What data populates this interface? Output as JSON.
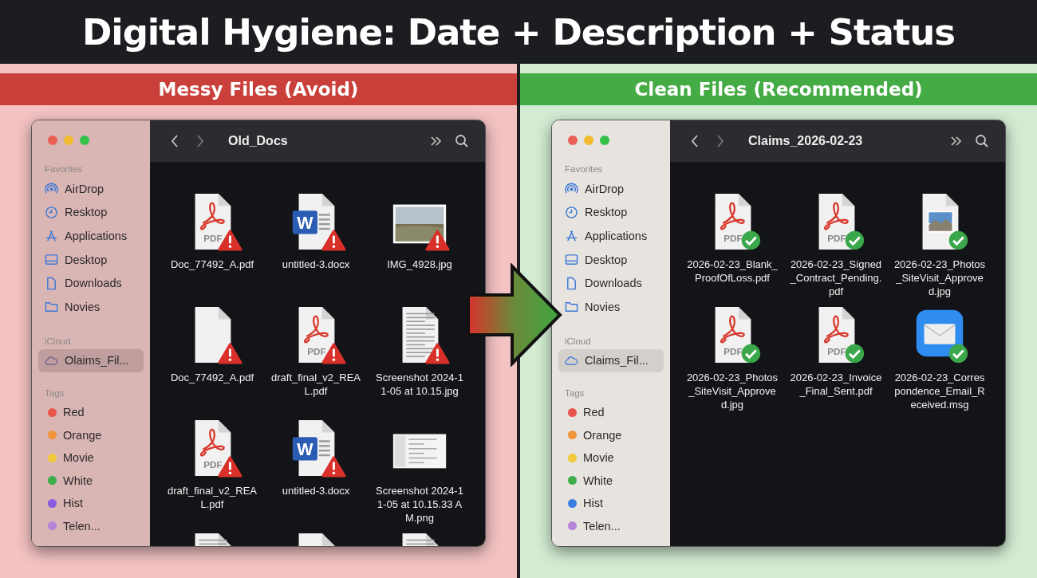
{
  "title": "Digital Hygiene: Date + Description + Status",
  "panels": [
    {
      "heading": "Messy Files (Avoid)",
      "recommended": false,
      "window": {
        "folder": "Old_Docs",
        "favorites_label": "Favorites",
        "favorites": [
          {
            "label": "AirDrop",
            "kind": "airdrop"
          },
          {
            "label": "Resktop",
            "kind": "clock"
          },
          {
            "label": "Applications",
            "kind": "apps"
          },
          {
            "label": "Desktop",
            "kind": "desktop"
          },
          {
            "label": "Downloads",
            "kind": "doc"
          },
          {
            "label": "Novies",
            "kind": "folder"
          }
        ],
        "icloud_label": "iCloud",
        "icloud": [
          {
            "label": "Olaims_Fil...",
            "selected": true
          }
        ],
        "tags_label": "Tags",
        "tags": [
          {
            "label": "Red",
            "color": "#e8554a"
          },
          {
            "label": "Orange",
            "color": "#f0953a"
          },
          {
            "label": "Movie",
            "color": "#f2c83c"
          },
          {
            "label": "White",
            "color": "#3fae4a"
          },
          {
            "label": "Hist",
            "color": "#8a5ce0"
          },
          {
            "label": "Telen...",
            "color": "#b884d8"
          }
        ],
        "files": [
          {
            "name": "Doc_77492_A.pdf",
            "kind": "pdf",
            "icon_text": "PDF",
            "warning": true,
            "approved": false
          },
          {
            "name": "untitled-3.docx",
            "kind": "word",
            "icon_text": "W",
            "warning": true,
            "approved": false
          },
          {
            "name": "IMG_4928.jpg",
            "kind": "photo",
            "warning": true,
            "approved": false
          },
          {
            "name": "Doc_77492_A.pdf",
            "kind": "blank",
            "warning": true,
            "approved": false
          },
          {
            "name": "draft_final_v2_REAL.pdf",
            "kind": "pdf",
            "icon_text": "PDF",
            "warning": true,
            "approved": false
          },
          {
            "name": "Screenshot 2024-11-05 at 10.15.jpg",
            "kind": "scan",
            "warning": true,
            "approved": false
          },
          {
            "name": "draft_final_v2_REAL.pdf",
            "kind": "pdf",
            "icon_text": "PDF",
            "warning": true,
            "approved": false
          },
          {
            "name": "untitled-3.docx",
            "kind": "word",
            "icon_text": "W",
            "warning": true,
            "approved": false
          },
          {
            "name": "Screenshot 2024-11-05 at 10.15.33 AM.png",
            "kind": "screenshot",
            "warning": false,
            "approved": false
          },
          {
            "kind": "scan"
          },
          {
            "kind": "blank"
          },
          {
            "kind": "scan"
          }
        ]
      }
    },
    {
      "heading": "Clean Files (Recommended)",
      "recommended": true,
      "window": {
        "folder": "Claims_2026-02-23",
        "favorites_label": "Favorites",
        "favorites": [
          {
            "label": "AirDrop",
            "kind": "airdrop"
          },
          {
            "label": "Resktop",
            "kind": "clock"
          },
          {
            "label": "Applications",
            "kind": "apps"
          },
          {
            "label": "Desktop",
            "kind": "desktop"
          },
          {
            "label": "Downloads",
            "kind": "doc"
          },
          {
            "label": "Novies",
            "kind": "folder"
          }
        ],
        "icloud_label": "iCloud",
        "icloud": [
          {
            "label": "Claims_Fil...",
            "selected": true
          }
        ],
        "tags_label": "Tags",
        "tags": [
          {
            "label": "Red",
            "color": "#e8554a"
          },
          {
            "label": "Orange",
            "color": "#f0953a"
          },
          {
            "label": "Movie",
            "color": "#f2c83c"
          },
          {
            "label": "White",
            "color": "#3fae4a"
          },
          {
            "label": "Hist",
            "color": "#3b7de0"
          },
          {
            "label": "Telen...",
            "color": "#b884d8"
          }
        ],
        "files": [
          {
            "name": "2026-02-23_Blank_ProofOfLoss.pdf",
            "kind": "pdf",
            "icon_text": "PDF",
            "warning": false,
            "approved": true
          },
          {
            "name": "2026-02-23_Signed_Contract_Pending.pdf",
            "kind": "pdf",
            "icon_text": "PDF",
            "warning": false,
            "approved": true
          },
          {
            "name": "2026-02-23_Photos_SiteVisit_Approved.jpg",
            "kind": "photo_doc",
            "warning": false,
            "approved": true
          },
          {
            "name": "2026-02-23_Photos_SiteVisit_Approved.jpg",
            "kind": "pdf",
            "icon_text": "PDF",
            "warning": false,
            "approved": true
          },
          {
            "name": "2026-02-23_Invoice_Final_Sent.pdf",
            "kind": "pdf",
            "icon_text": "PDF",
            "warning": false,
            "approved": true
          },
          {
            "name": "2026-02-23_Correspondence_Email_Received.msg",
            "kind": "mail",
            "warning": false,
            "approved": true
          }
        ]
      }
    }
  ]
}
